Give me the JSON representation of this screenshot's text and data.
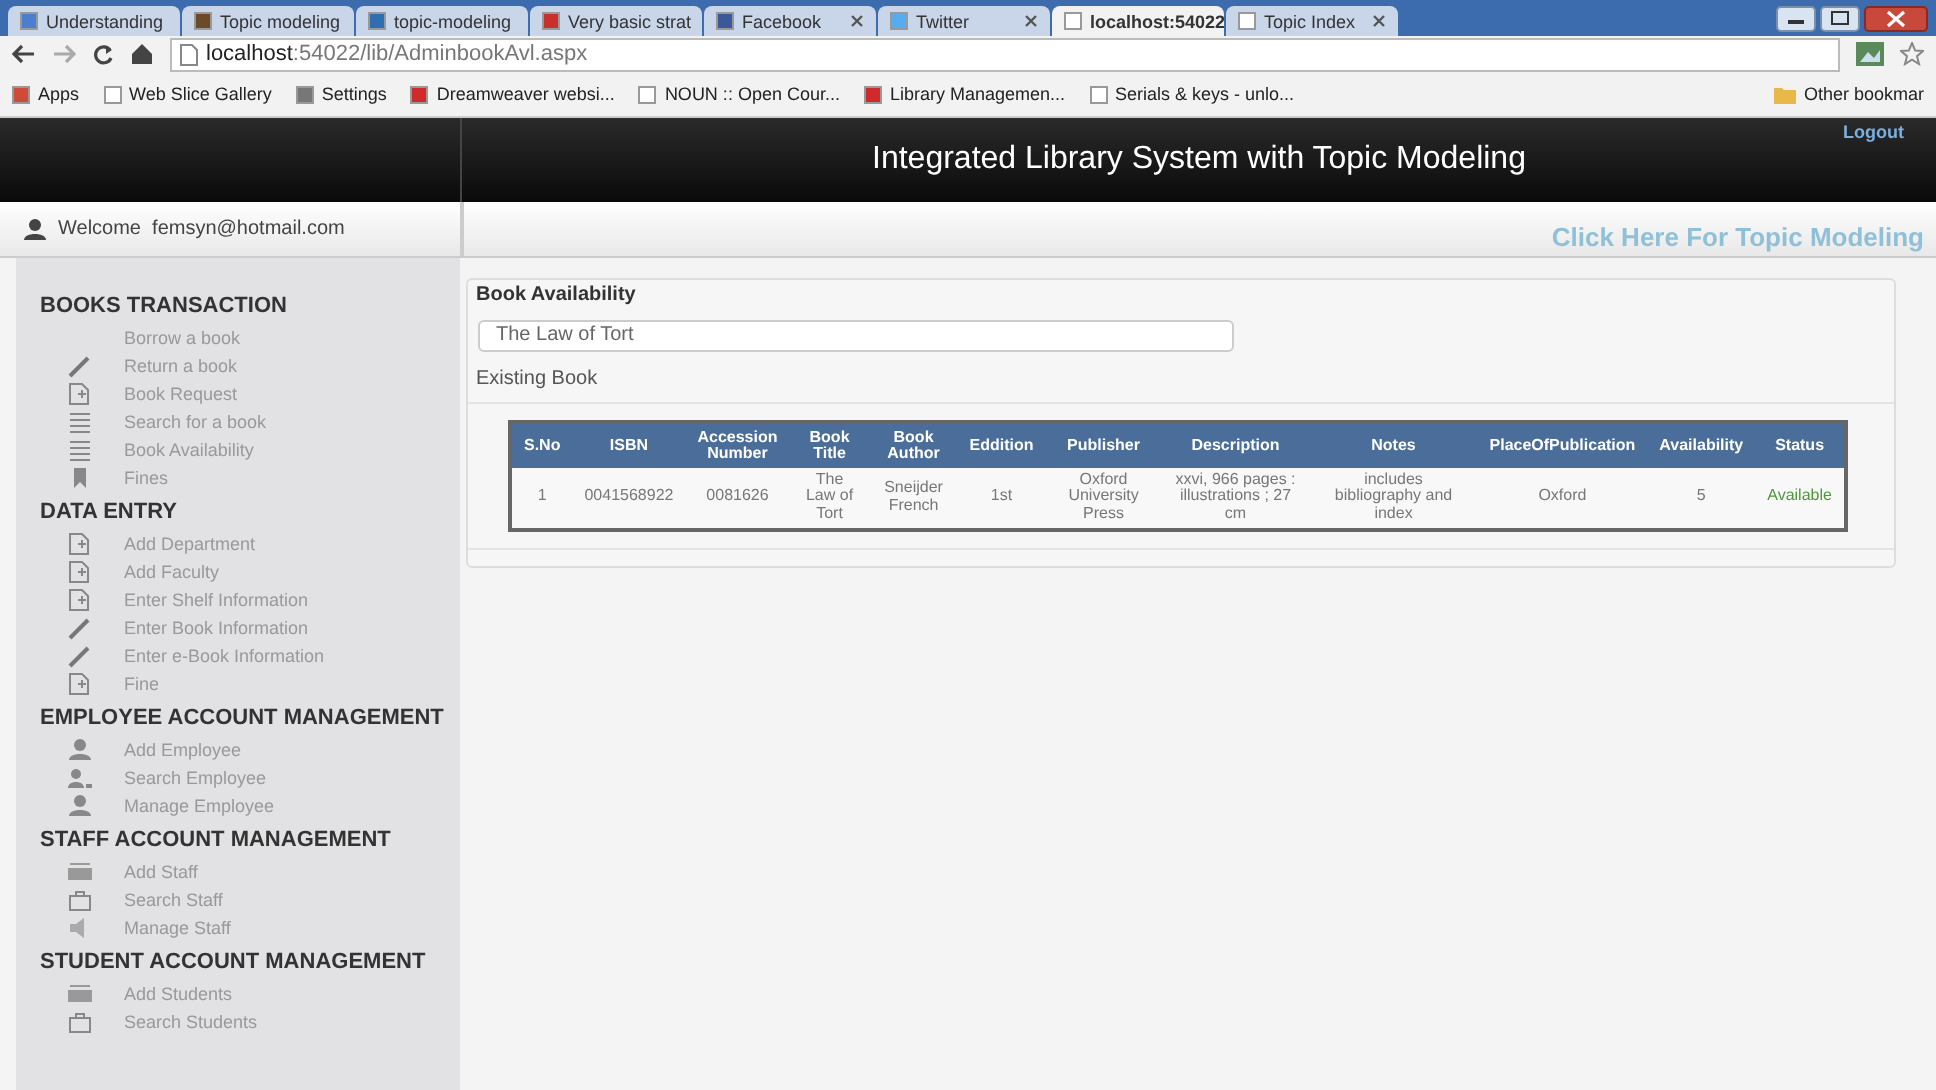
{
  "browser": {
    "tabs": [
      {
        "label": "Understanding",
        "color": "#4a7fd0",
        "selected": false
      },
      {
        "label": "Topic modeling",
        "color": "#6b4a2a",
        "selected": false
      },
      {
        "label": "topic-modeling",
        "color": "#2f6fb0",
        "selected": false
      },
      {
        "label": "Very basic strat",
        "color": "#c8302c",
        "selected": false
      },
      {
        "label": "Facebook",
        "color": "#3b5998",
        "selected": false
      },
      {
        "label": "Twitter",
        "color": "#55acee",
        "selected": false
      },
      {
        "label": "localhost:54022",
        "color": "#ffffff",
        "selected": true
      },
      {
        "label": "Topic Index",
        "color": "#ffffff",
        "selected": false
      }
    ],
    "address": {
      "host": "localhost",
      "path": ":54022/lib/AdminbookAvl.aspx"
    },
    "bookmarks": [
      {
        "label": "Apps",
        "color": "#d04a3a"
      },
      {
        "label": "Web Slice Gallery",
        "color": "#ffffff"
      },
      {
        "label": "Settings",
        "color": "#777777"
      },
      {
        "label": "Dreamweaver websi...",
        "color": "#d02a2a"
      },
      {
        "label": "NOUN :: Open Cour...",
        "color": "#ffffff"
      },
      {
        "label": "Library Managemen...",
        "color": "#d02a2a"
      },
      {
        "label": "Serials & keys - unlo...",
        "color": "#ffffff"
      }
    ],
    "other_bookmarks": "Other bookmar"
  },
  "header": {
    "title": "Integrated Library System with Topic Modeling",
    "logout": "Logout"
  },
  "welcome": "Welcome  femsyn@hotmail.com",
  "topic_link": "Click Here For Topic Modeling",
  "sidebar": [
    {
      "title": "BOOKS TRANSACTION",
      "items": [
        "Borrow a book",
        "Return a book",
        "Book Request",
        "Search for a book",
        "Book Availability",
        "Fines"
      ]
    },
    {
      "title": "DATA ENTRY",
      "items": [
        "Add Department",
        "Add Faculty",
        "Enter Shelf Information",
        "Enter Book Information",
        "Enter e-Book Information",
        "Fine"
      ]
    },
    {
      "title": "EMPLOYEE ACCOUNT MANAGEMENT",
      "items": [
        "Add Employee",
        "Search Employee",
        "Manage Employee"
      ]
    },
    {
      "title": "STAFF ACCOUNT MANAGEMENT",
      "items": [
        "Add Staff",
        "Search Staff",
        "Manage Staff"
      ]
    },
    {
      "title": "STUDENT ACCOUNT MANAGEMENT",
      "items": [
        "Add Students",
        "Search Students"
      ]
    }
  ],
  "panel": {
    "title": "Book Availability",
    "search_value": "The Law of Tort",
    "group_title": "Existing Book",
    "table": {
      "columns": [
        "S.No",
        "ISBN",
        "Accession Number",
        "Book Title",
        "Book Author",
        "Eddition",
        "Publisher",
        "Description",
        "Notes",
        "PlaceOfPublication",
        "Availability",
        "Status"
      ],
      "rows": [
        [
          "1",
          "0041568922",
          "0081626",
          "The Law of Tort",
          "Sneijder French",
          "1st",
          "Oxford University Press",
          "xxvi, 966 pages : illustrations ; 27 cm",
          "includes bibliography and index",
          "Oxford",
          "5",
          "Available"
        ]
      ]
    }
  }
}
